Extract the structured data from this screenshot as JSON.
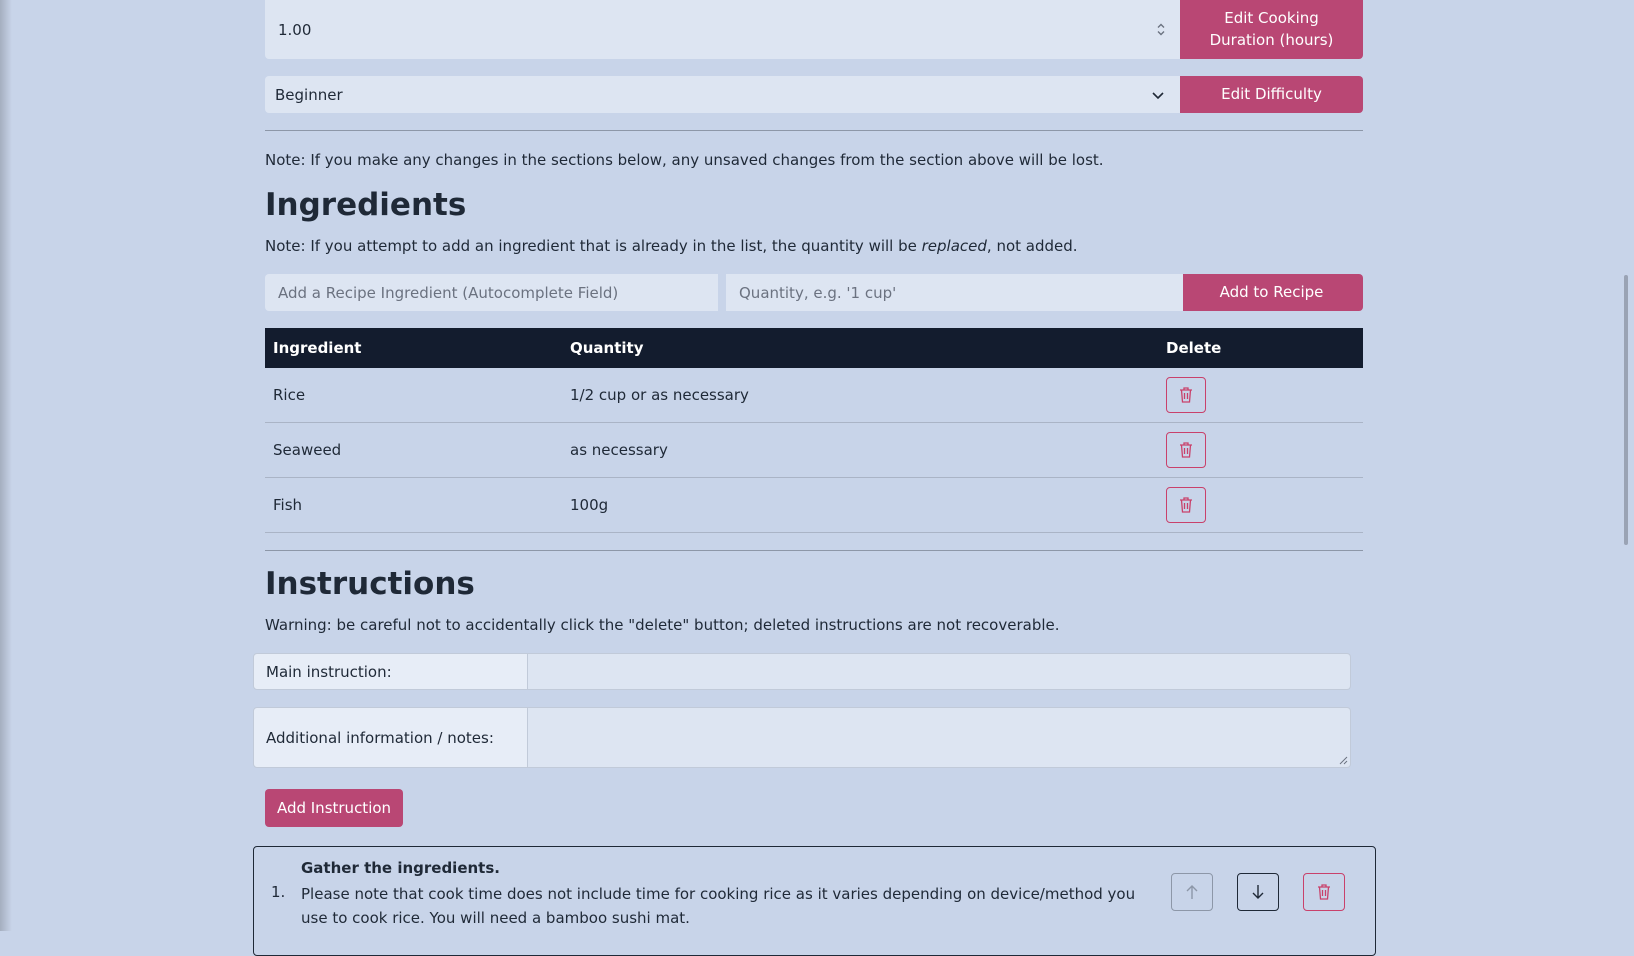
{
  "details": {
    "duration_value": "1.00",
    "duration_button": "Edit Cooking Duration (hours)",
    "difficulty_value": "Beginner",
    "difficulty_button": "Edit Difficulty",
    "unsaved_note": "Note: If you make any changes in the sections below, any unsaved changes from the section above will be lost."
  },
  "ingredients": {
    "title": "Ingredients",
    "note_prefix": "Note: If you attempt to add an ingredient that is already in the list, the quantity will be ",
    "note_emphasis": "replaced",
    "note_suffix": ", not added.",
    "ingredient_placeholder": "Add a Recipe Ingredient (Autocomplete Field)",
    "quantity_placeholder": "Quantity, e.g. '1 cup'",
    "add_button": "Add to Recipe",
    "columns": [
      "Ingredient",
      "Quantity",
      "Delete"
    ],
    "rows": [
      {
        "name": "Rice",
        "quantity": "1/2 cup or as necessary"
      },
      {
        "name": "Seaweed",
        "quantity": "as necessary"
      },
      {
        "name": "Fish",
        "quantity": "100g"
      }
    ]
  },
  "instructions": {
    "title": "Instructions",
    "warning": "Warning: be careful not to accidentally click the \"delete\" button; deleted instructions are not recoverable.",
    "main_label": "Main instruction:",
    "notes_label": "Additional information / notes:",
    "add_button": "Add Instruction",
    "items": [
      {
        "number": "1.",
        "title": "Gather the ingredients.",
        "description": "Please note that cook time does not include time for cooking rice as it varies depending on device/method you use to cook rice. You will need a bamboo sushi mat."
      }
    ]
  },
  "colors": {
    "accent": "#b94774",
    "background": "#c8d4e9",
    "table_header": "#131c2e"
  },
  "icons": [
    "trash-icon",
    "arrow-up-icon",
    "arrow-down-icon",
    "chevron-down-icon",
    "spinner-icon"
  ]
}
